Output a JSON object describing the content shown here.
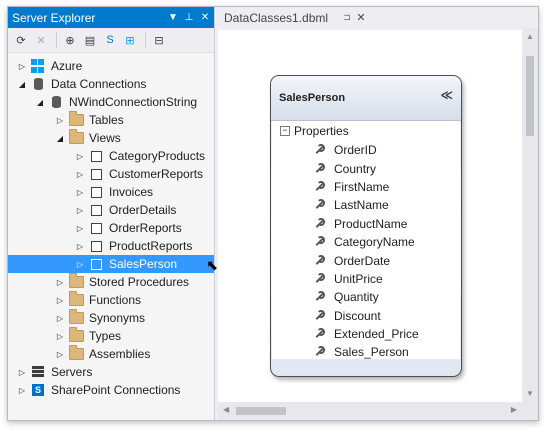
{
  "server_explorer": {
    "title": "Server Explorer",
    "title_buttons": [
      "▼",
      "⊥",
      "✕"
    ],
    "toolbar_icons": [
      "refresh-icon",
      "stop-icon",
      "connect-to-database-icon",
      "connect-to-server-icon",
      "connect-to-sharepoint-icon",
      "connect-to-azure-icon",
      "properties-icon"
    ],
    "tree": [
      {
        "label": "Azure",
        "level": 0,
        "expander": "▷",
        "icon": "azure"
      },
      {
        "label": "Data Connections",
        "level": 0,
        "expander": "◢",
        "icon": "db"
      },
      {
        "label": "NWindConnectionString",
        "level": 1,
        "expander": "◢",
        "icon": "db"
      },
      {
        "label": "Tables",
        "level": 2,
        "expander": "▷",
        "icon": "folder"
      },
      {
        "label": "Views",
        "level": 2,
        "expander": "◢",
        "icon": "folder"
      },
      {
        "label": "CategoryProducts",
        "level": 3,
        "expander": "▷",
        "icon": "view"
      },
      {
        "label": "CustomerReports",
        "level": 3,
        "expander": "▷",
        "icon": "view"
      },
      {
        "label": "Invoices",
        "level": 3,
        "expander": "▷",
        "icon": "view"
      },
      {
        "label": "OrderDetails",
        "level": 3,
        "expander": "▷",
        "icon": "view"
      },
      {
        "label": "OrderReports",
        "level": 3,
        "expander": "▷",
        "icon": "view"
      },
      {
        "label": "ProductReports",
        "level": 3,
        "expander": "▷",
        "icon": "view"
      },
      {
        "label": "SalesPerson",
        "level": 3,
        "expander": "▷",
        "icon": "view",
        "selected": true
      },
      {
        "label": "Stored Procedures",
        "level": 2,
        "expander": "▷",
        "icon": "folder"
      },
      {
        "label": "Functions",
        "level": 2,
        "expander": "▷",
        "icon": "folder"
      },
      {
        "label": "Synonyms",
        "level": 2,
        "expander": "▷",
        "icon": "folder"
      },
      {
        "label": "Types",
        "level": 2,
        "expander": "▷",
        "icon": "folder"
      },
      {
        "label": "Assemblies",
        "level": 2,
        "expander": "▷",
        "icon": "folder"
      },
      {
        "label": "Servers",
        "level": 0,
        "expander": "▷",
        "icon": "server"
      },
      {
        "label": "SharePoint Connections",
        "level": 0,
        "expander": "▷",
        "icon": "sharepoint"
      }
    ]
  },
  "document_tab": {
    "label": "DataClasses1.dbml",
    "pin": "⊐",
    "close": "✕"
  },
  "entity": {
    "name": "SalesPerson",
    "collapse_glyph": "≪",
    "section_label": "Properties",
    "properties": [
      "OrderID",
      "Country",
      "FirstName",
      "LastName",
      "ProductName",
      "CategoryName",
      "OrderDate",
      "UnitPrice",
      "Quantity",
      "Discount",
      "Extended_Price",
      "Sales_Person"
    ]
  },
  "colors": {
    "accent": "#007acc",
    "selection": "#3399ff",
    "folder": "#dcb67a"
  }
}
